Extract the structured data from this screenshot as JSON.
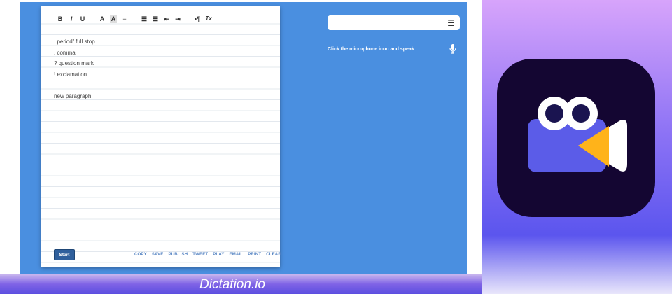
{
  "toolbar": {
    "bold": "B",
    "italic": "I",
    "underline": "U",
    "font_color": "A",
    "bg_color": "A",
    "align": "≡",
    "ordered_list": "☰",
    "bullet_list": "☰",
    "outdent": "⇤",
    "indent": "⇥",
    "paragraph": "•¶",
    "clear_format": "Tx"
  },
  "editor": {
    "lines": [
      ". period/ full stop",
      ", comma",
      "? question mark",
      "! exclamation",
      "",
      "new paragraph"
    ]
  },
  "start_label": "Start",
  "actions": [
    "COPY",
    "SAVE",
    "PUBLISH",
    "TWEET",
    "PLAY",
    "EMAIL",
    "PRINT",
    "CLEAR"
  ],
  "search": {
    "value": "",
    "menu_icon": "☰"
  },
  "hint": "Click the microphone icon and speak",
  "brand": "Dictation.io",
  "colors": {
    "blue": "#4a8fe0",
    "app_bg": "#140632",
    "camera": "#5b5ce8",
    "lens": "#ffb31a"
  }
}
